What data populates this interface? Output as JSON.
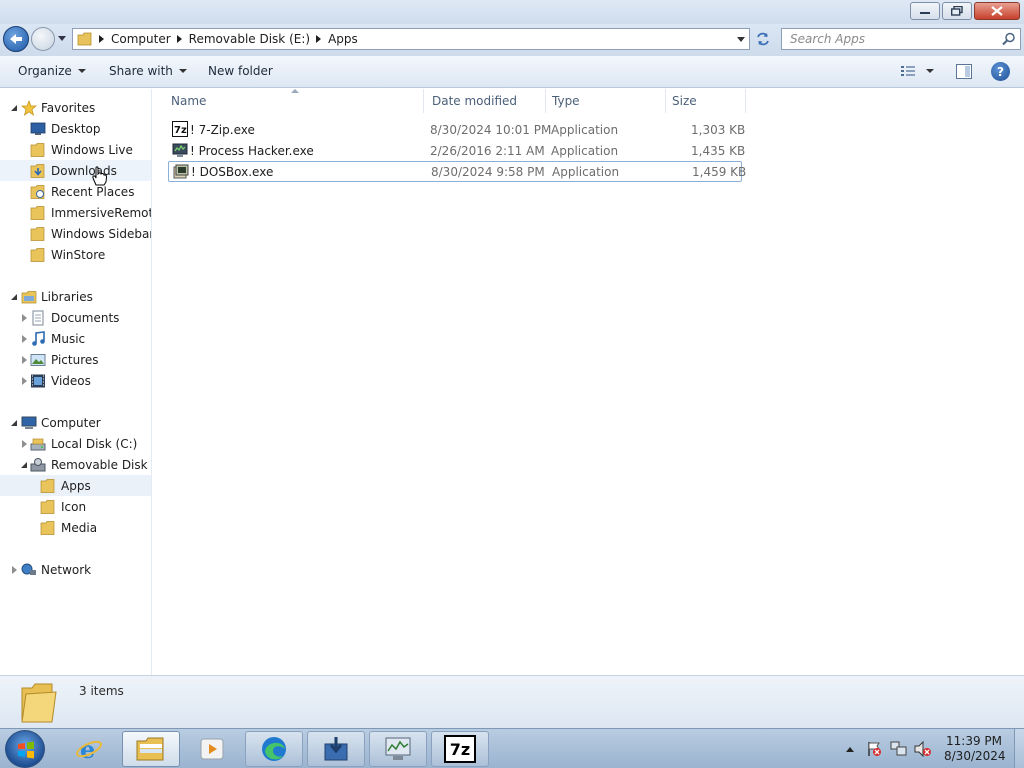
{
  "address": {
    "crumbs": [
      "Computer",
      "Removable Disk (E:)",
      "Apps"
    ]
  },
  "search": {
    "placeholder": "Search Apps"
  },
  "toolbar": {
    "organize": "Organize",
    "share_with": "Share with",
    "new_folder": "New folder"
  },
  "nav": {
    "favorites": {
      "label": "Favorites",
      "items": [
        "Desktop",
        "Windows Live",
        "Downloads",
        "Recent Places",
        "ImmersiveRemoteD",
        "Windows Sidebar",
        "WinStore"
      ]
    },
    "libraries": {
      "label": "Libraries",
      "items": [
        "Documents",
        "Music",
        "Pictures",
        "Videos"
      ]
    },
    "computer": {
      "label": "Computer",
      "local_disk": "Local Disk (C:)",
      "removable": "Removable Disk (E:",
      "removable_children": [
        "Apps",
        "Icon",
        "Media"
      ]
    },
    "network": "Network"
  },
  "columns": {
    "name": "Name",
    "date": "Date modified",
    "type": "Type",
    "size": "Size"
  },
  "files": [
    {
      "name": "! 7-Zip.exe",
      "date": "8/30/2024 10:01 PM",
      "type": "Application",
      "size": "1,303 KB",
      "icon": "7zip-icon"
    },
    {
      "name": "! Process Hacker.exe",
      "date": "2/26/2016 2:11 AM",
      "type": "Application",
      "size": "1,435 KB",
      "icon": "process-hacker-icon"
    },
    {
      "name": "! DOSBox.exe",
      "date": "8/30/2024 9:58 PM",
      "type": "Application",
      "size": "1,459 KB",
      "icon": "dosbox-icon"
    }
  ],
  "details": {
    "count": "3 items"
  },
  "taskbar": {
    "clock_time": "11:39 PM",
    "clock_date": "8/30/2024",
    "sevenzip_label": "7z"
  }
}
